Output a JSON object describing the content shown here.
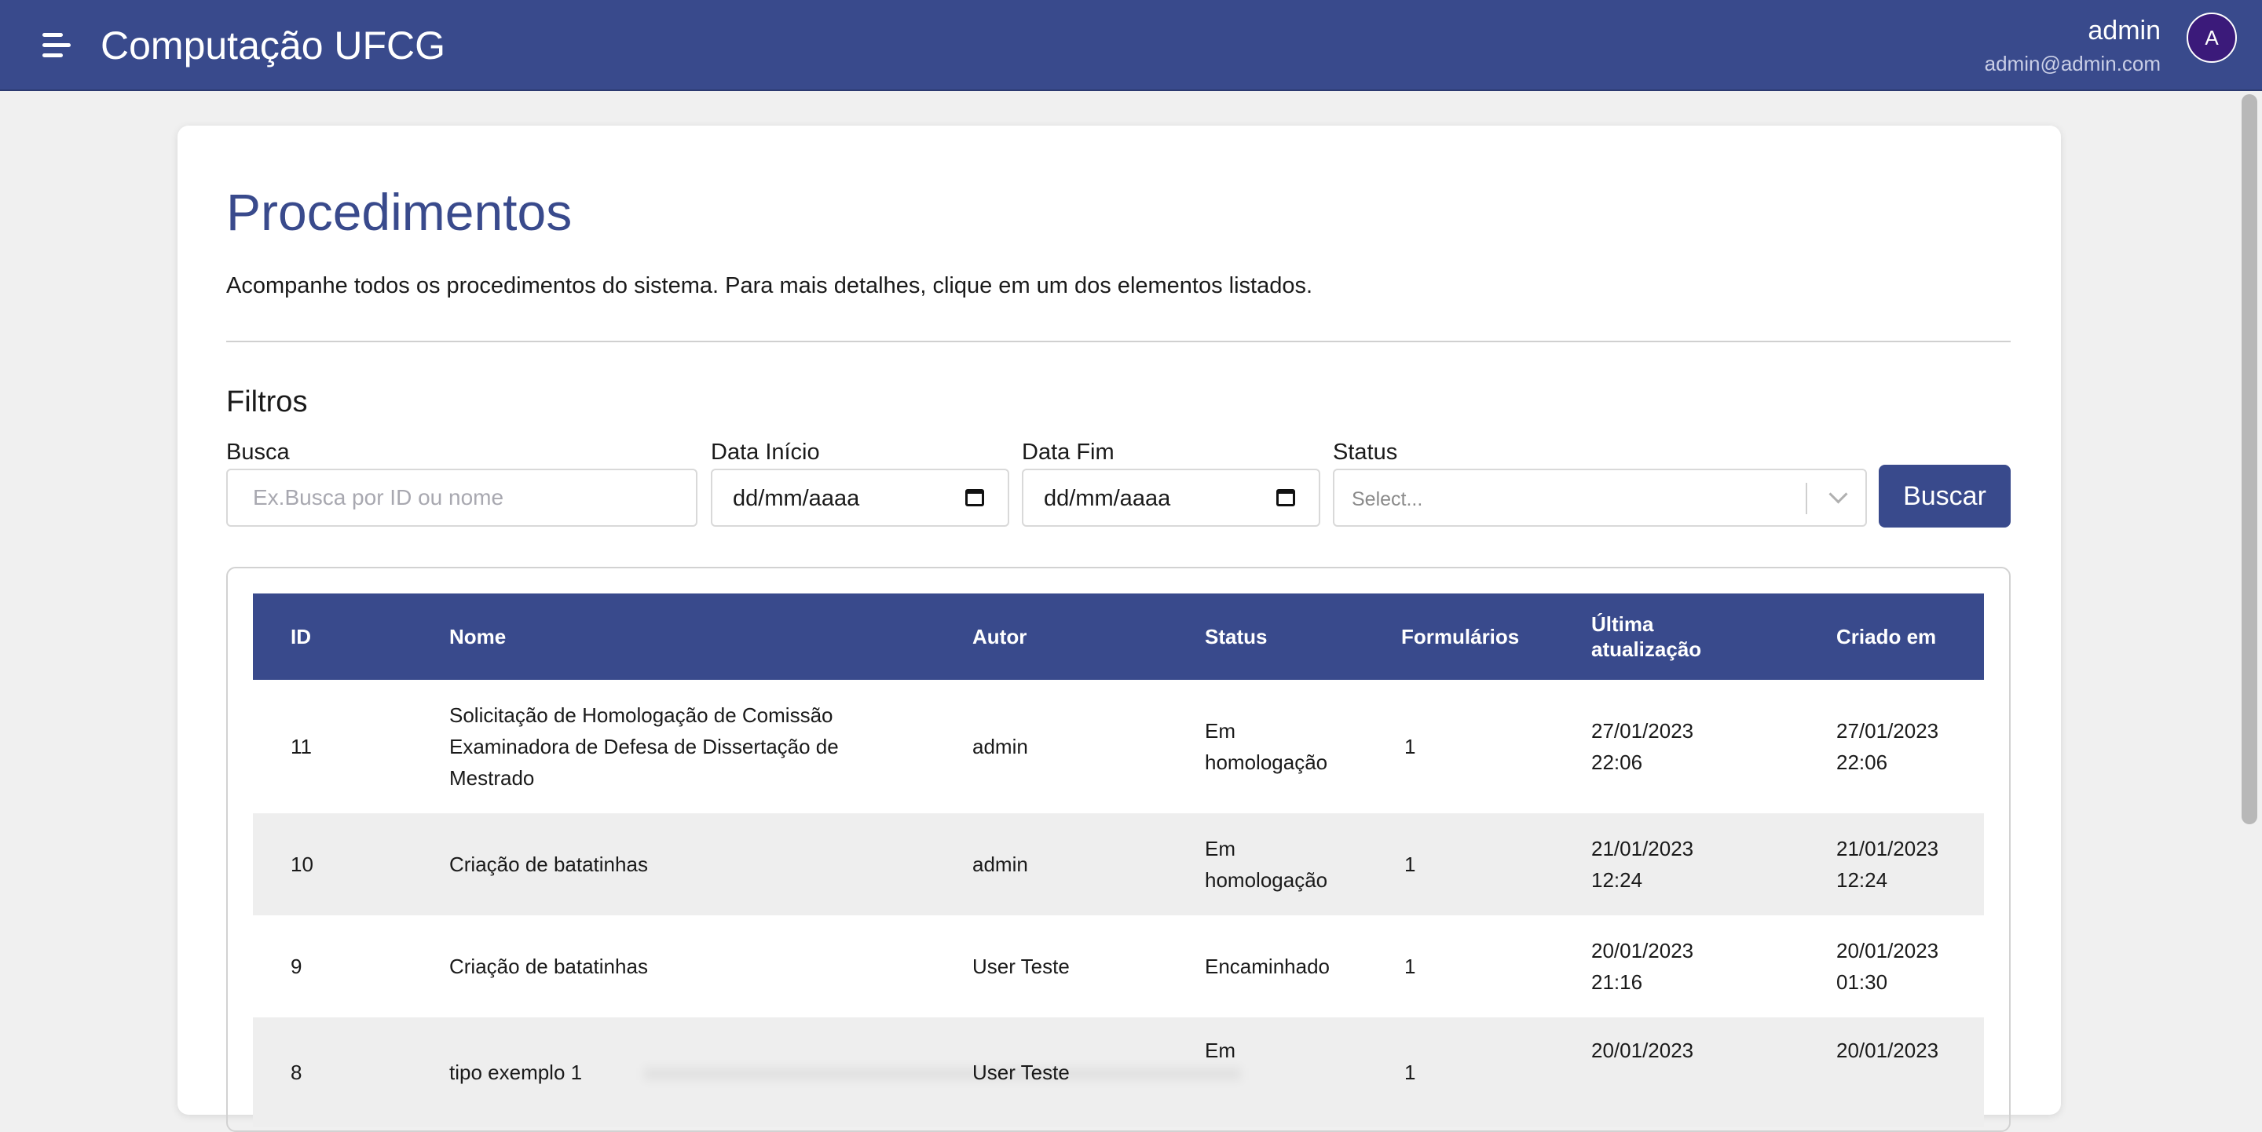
{
  "header": {
    "title": "Computação UFCG",
    "user_name": "admin",
    "user_email": "admin@admin.com",
    "avatar_initial": "A"
  },
  "page": {
    "title": "Procedimentos",
    "description": "Acompanhe todos os procedimentos do sistema. Para mais detalhes, clique em um dos elementos listados."
  },
  "filters": {
    "title": "Filtros",
    "search_label": "Busca",
    "search_placeholder": "Ex.Busca por ID ou nome",
    "start_label": "Data Início",
    "start_value": "dd/mm/aaaa",
    "end_label": "Data Fim",
    "end_value": "dd/mm/aaaa",
    "status_label": "Status",
    "status_placeholder": "Select...",
    "button_label": "Buscar"
  },
  "table": {
    "columns": [
      "ID",
      "Nome",
      "Autor",
      "Status",
      "Formulários",
      "Última atualização",
      "Criado em"
    ],
    "rows": [
      {
        "id": "11",
        "nome": "Solicitação de Homologação de Comissão Examinadora de Defesa de Dissertação de Mestrado",
        "autor": "admin",
        "status": "Em homologação",
        "formularios": "1",
        "ultima": "27/01/2023 22:06",
        "criado": "27/01/2023 22:06"
      },
      {
        "id": "10",
        "nome": "Criação de batatinhas",
        "autor": "admin",
        "status": "Em homologação",
        "formularios": "1",
        "ultima": "21/01/2023 12:24",
        "criado": "21/01/2023 12:24"
      },
      {
        "id": "9",
        "nome": "Criação de batatinhas",
        "autor": "User Teste",
        "status": "Encaminhado",
        "formularios": "1",
        "ultima": "20/01/2023 21:16",
        "criado": "20/01/2023 01:30"
      },
      {
        "id": "8",
        "nome": "tipo exemplo 1",
        "autor": "User Teste",
        "status": "Em",
        "formularios": "1",
        "ultima": "20/01/2023",
        "criado": "20/01/2023"
      }
    ]
  }
}
